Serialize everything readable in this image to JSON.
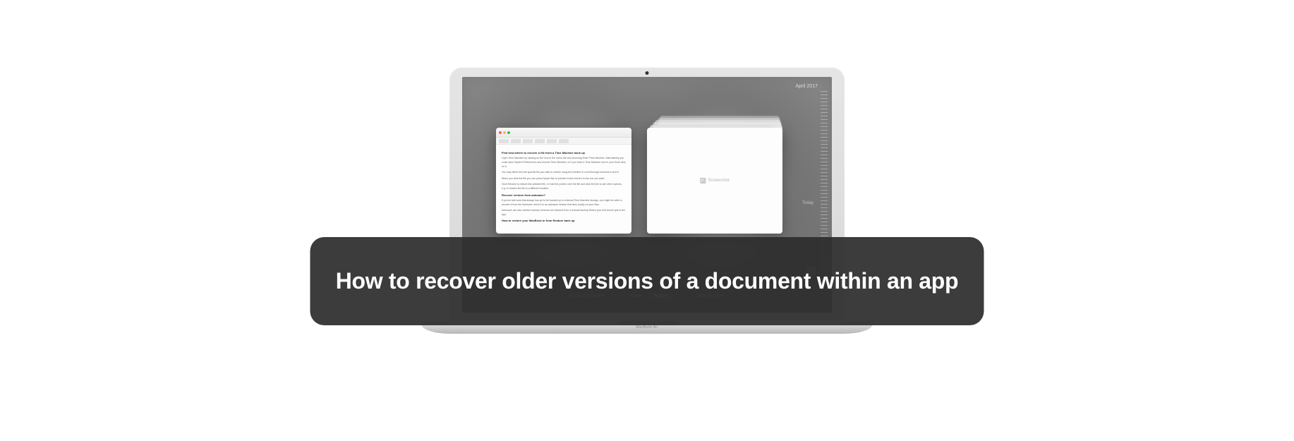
{
  "banner": {
    "title": "How to recover older versions of a document within an app"
  },
  "laptop": {
    "brand": "MacBook Air"
  },
  "versions_ui": {
    "timeline_date": "April 2017",
    "timeline_today": "Today",
    "stack_placeholder": "Screenshot",
    "controls": {
      "left_label": "Current Document",
      "done": "Done",
      "restore": "Restore",
      "right_label": "Today 11:30am"
    },
    "document": {
      "heading1": "Find how where to recover a file from a Time Machine back up",
      "para1": "Open Time Machine by clicking on the icon in the menu bar and choosing Enter Time Machine. Alternatively you could open System Preferences and choose Time Machine, or if you have a Time Machine icon in your Dock click on it.",
      "para2": "You may either find the specific file you wish to restore using the timeline or scroll through versions to find it.",
      "para3": "When you click the file you can press Space Bar to preview it and check it is the one you want.",
      "para4": "Click Restore to restore the selected file, or hold the pointer over the file and click the link to see other options, e.g. to restore the file to a different location.",
      "heading2": "Recover version from autosave?",
      "para5": "If you've lost work that always has yet to be backed up to external Time Machine storage, you might be able to recover it from the Autosave, since it is an autosave version that lives locally on your Mac.",
      "para6": "Autosave can also retrieve backup versions not restored from a manual backup before your first forced quit of the app.",
      "heading3": "How to restore your MacBook in from Restore back up"
    }
  }
}
